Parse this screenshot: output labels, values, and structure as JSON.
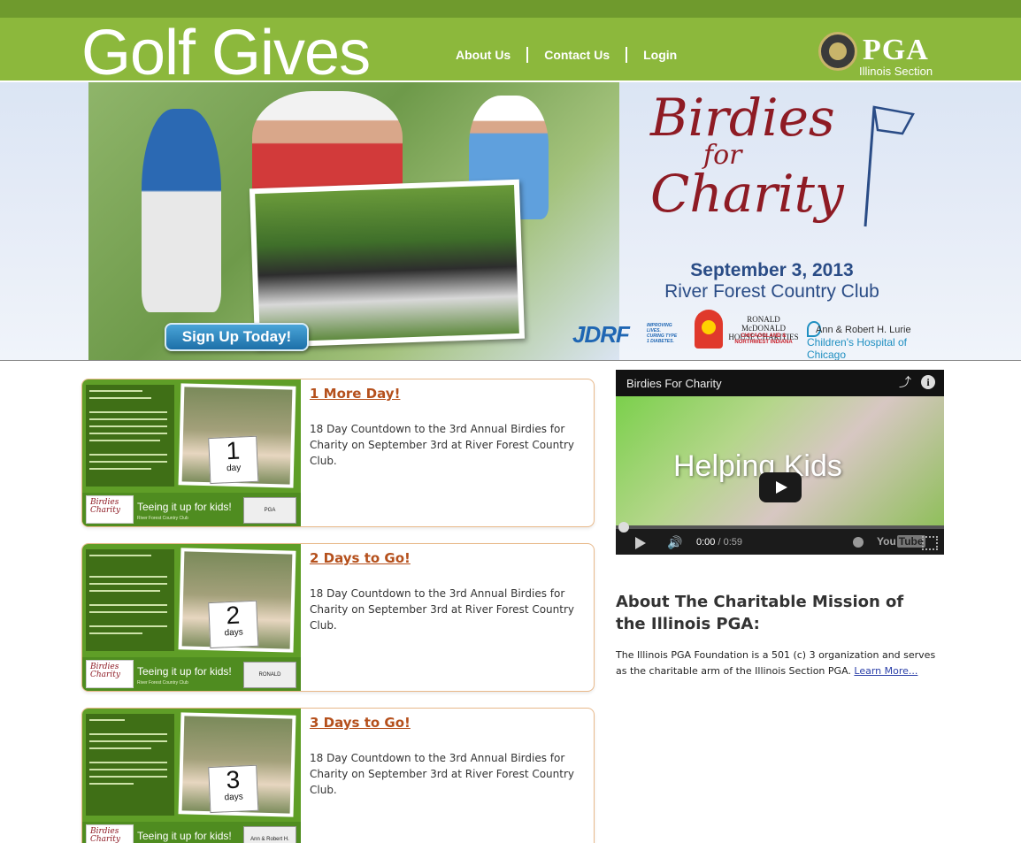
{
  "header": {
    "logo_text": "Golf Gives",
    "nav": [
      "About Us",
      "Contact Us",
      "Login"
    ],
    "pga_name": "PGA",
    "pga_section": "Illinois Section"
  },
  "banner": {
    "signup_label": "Sign Up Today!",
    "event_title_1": "Birdies",
    "event_title_2": "for",
    "event_title_3": "Charity",
    "event_date": "September 3, 2013",
    "event_venue": "River Forest Country Club",
    "sponsors": {
      "jdrf": "JDRF",
      "jdrf_tag": "IMPROVING LIVES. CURING TYPE 1 DIABETES.",
      "rmhc_name": "RONALD McDONALD HOUSE CHARITIES",
      "rmhc_region": "CHICAGOLAND & NORTHWEST INDIANA",
      "lurie_1": "Ann & Robert H. Lurie",
      "lurie_2": "Children's Hospital of Chicago"
    }
  },
  "posts": [
    {
      "title": "1 More Day!",
      "body": "18 Day Countdown to the 3rd Annual Birdies for Charity on September 3rd at River Forest Country Club.",
      "thumb_number": "1",
      "thumb_unit": "day",
      "thumb_tagline": "Teeing it up for kids!",
      "thumb_badge": "PGA"
    },
    {
      "title": "2 Days to Go!",
      "body": "18 Day Countdown to the 3rd Annual Birdies for Charity on September 3rd at River Forest Country Club.",
      "thumb_number": "2",
      "thumb_unit": "days",
      "thumb_tagline": "Teeing it up for kids!",
      "thumb_badge": "RONALD McDONALD HOUSE"
    },
    {
      "title": "3 Days to Go!",
      "body": "18 Day Countdown to the 3rd Annual Birdies for Charity on September 3rd at River Forest Country Club.",
      "thumb_number": "3",
      "thumb_unit": "days",
      "thumb_tagline": "Teeing it up for kids!",
      "thumb_badge": "Ann & Robert H. Lurie"
    }
  ],
  "video": {
    "title": "Birdies For Charity",
    "overlay_text": "Helping Kids",
    "time_current": "0:00",
    "time_total": "/ 0:59",
    "yt_label_1": "You",
    "yt_label_2": "Tube",
    "progress": 0
  },
  "about": {
    "heading": "About The Charitable Mission of the Illinois PGA:",
    "text": "The Illinois PGA Foundation is a 501 (c) 3 organization and serves as the charitable arm of the Illinois Section PGA.",
    "link": "Learn More..."
  },
  "colors": {
    "header_green": "#8cb83c",
    "topbar_green": "#6f9a2d",
    "post_title": "#b5501c",
    "event_red": "#8e1b24",
    "event_blue": "#2a4c86"
  }
}
